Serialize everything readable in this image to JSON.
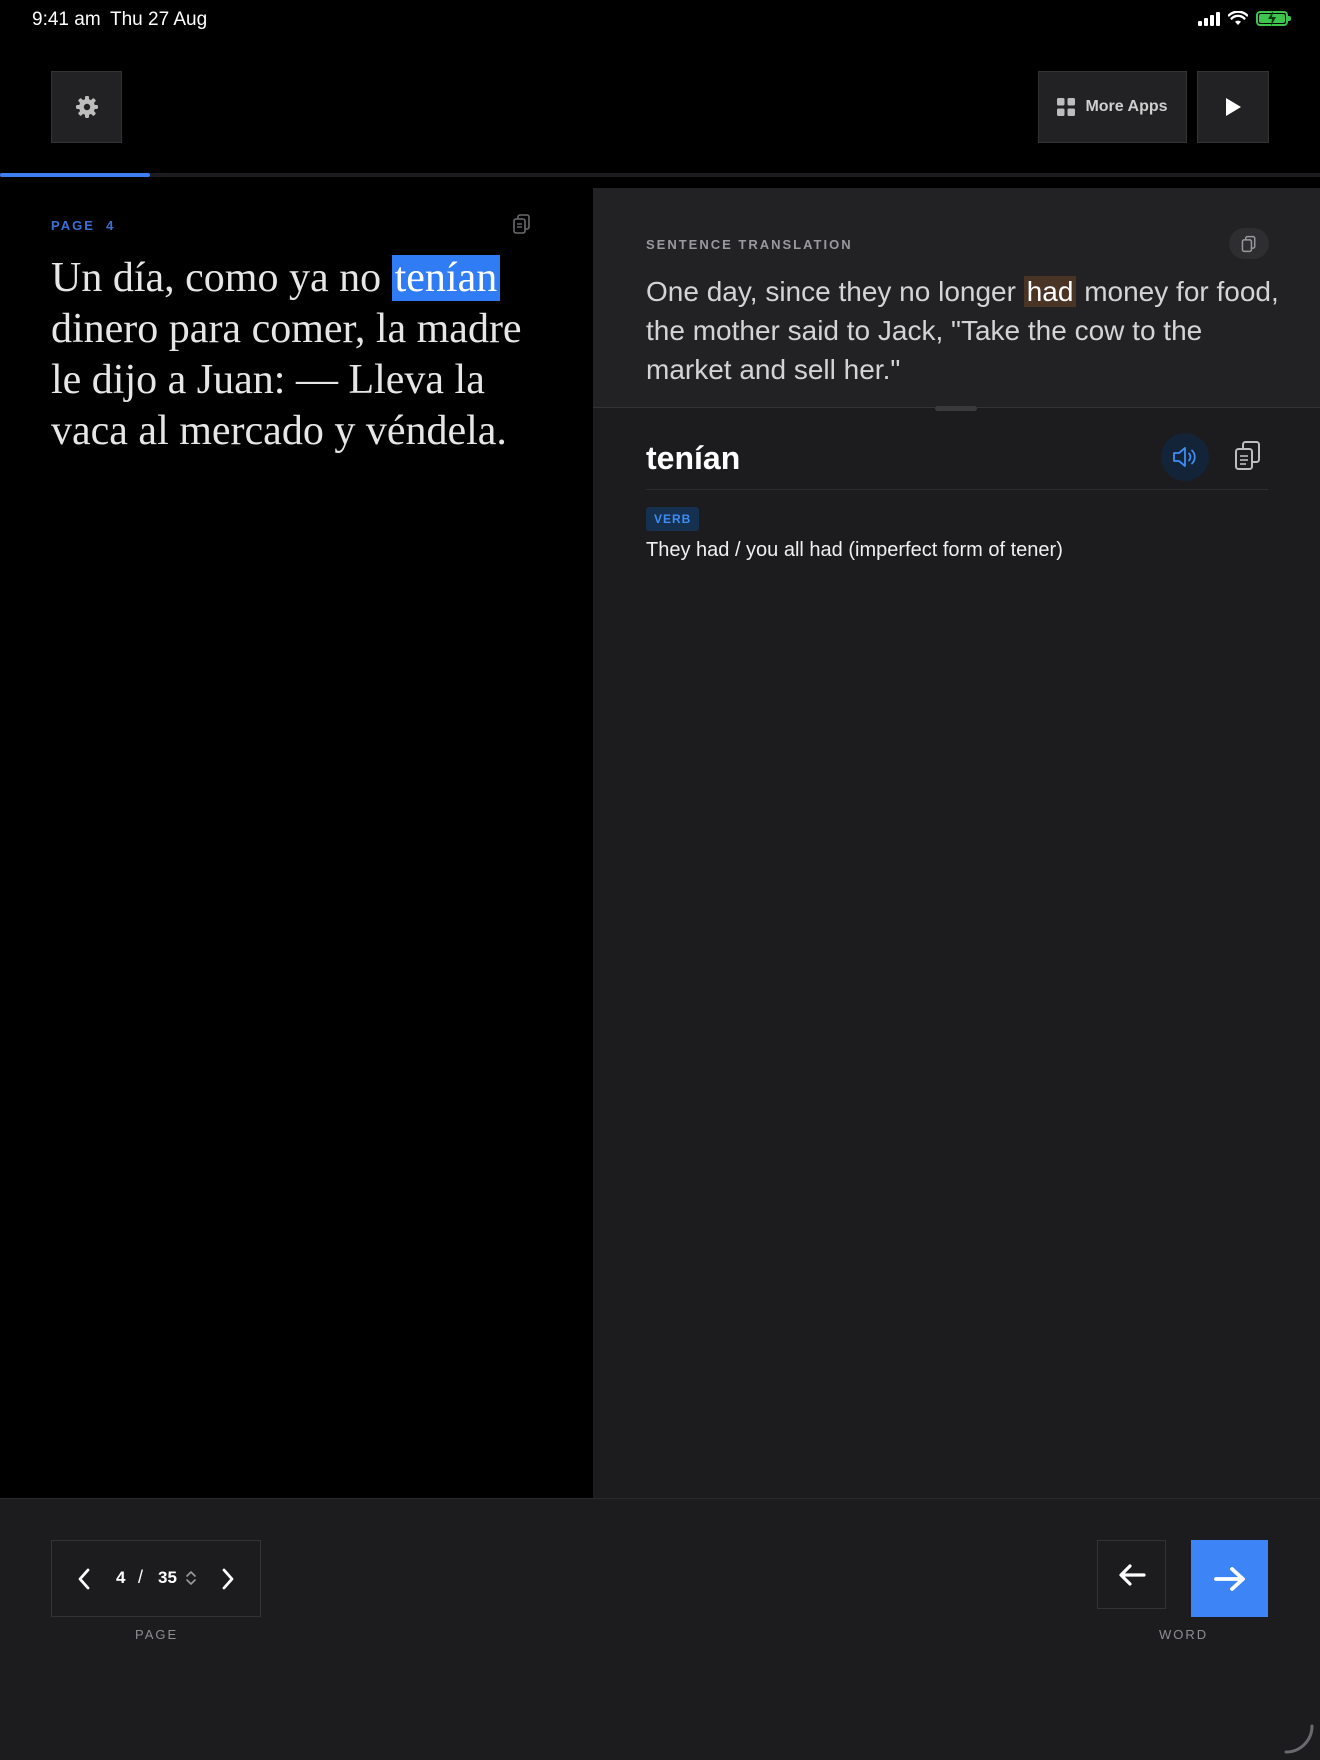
{
  "status_bar": {
    "time": "9:41 am",
    "date": "Thu 27 Aug",
    "battery_color": "#3cc44c"
  },
  "toolbar": {
    "settings_icon": "gear-icon",
    "more_apps_label": "More Apps",
    "more_apps_icon": "grid-icon",
    "play_icon": "play-icon"
  },
  "reading_progress": 0.114,
  "reader": {
    "page_label": "PAGE  4",
    "text_before": "Un día, como ya no ",
    "highlighted_word": "tenían",
    "text_after": " dinero para comer, la madre le dijo a Juan: — Lleva la vaca al mercado y véndela."
  },
  "translation": {
    "section_label": "SENTENCE TRANSLATION",
    "text_before": "One day, since they no longer ",
    "highlighted_word": "had",
    "text_after": " money for food, the mother said to Jack, \"Take the cow to the market and sell her.\""
  },
  "word_detail": {
    "word": "tenían",
    "part_of_speech": "VERB",
    "definition": "They had / you all had (imperfect form of tener)"
  },
  "pagination": {
    "current": "4",
    "separator": "/",
    "total": "35",
    "caption": "PAGE"
  },
  "word_nav": {
    "caption": "WORD"
  },
  "colors": {
    "accent": "#3d84f7",
    "word_highlight": "#2f7cf4",
    "translation_highlight": "#4a3426",
    "panel_bg": "#1c1c1e"
  }
}
